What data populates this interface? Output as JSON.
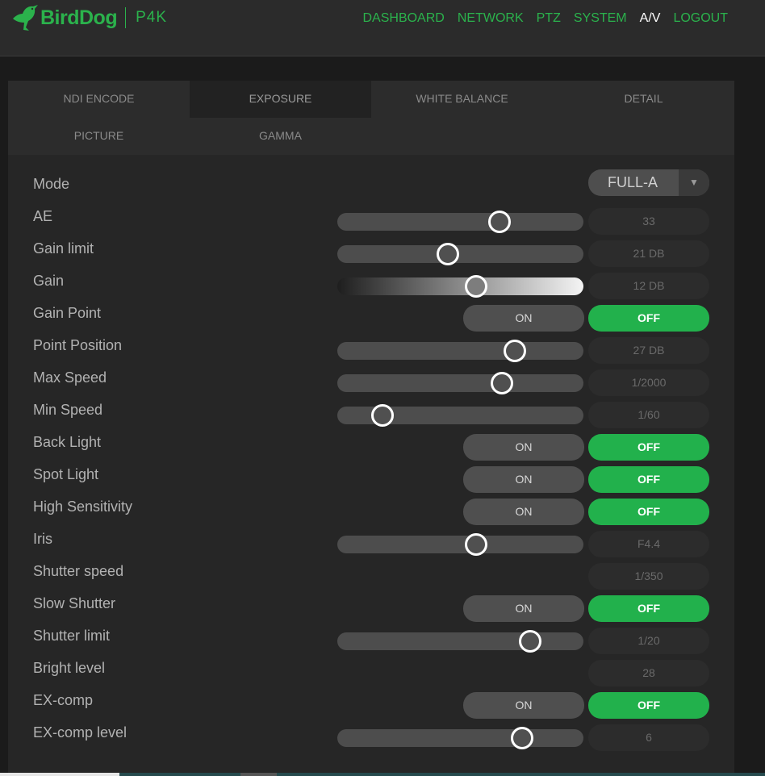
{
  "header": {
    "brand": "BirdDog",
    "model": "P4K",
    "nav": [
      {
        "label": "DASHBOARD",
        "active": false
      },
      {
        "label": "NETWORK",
        "active": false
      },
      {
        "label": "PTZ",
        "active": false
      },
      {
        "label": "SYSTEM",
        "active": false
      },
      {
        "label": "A/V",
        "active": true
      },
      {
        "label": "LOGOUT",
        "active": false
      }
    ]
  },
  "tabs": [
    {
      "label": "NDI ENCODE",
      "active": false
    },
    {
      "label": "EXPOSURE",
      "active": true
    },
    {
      "label": "WHITE BALANCE",
      "active": false
    },
    {
      "label": "DETAIL",
      "active": false
    },
    {
      "label": "PICTURE",
      "active": false
    },
    {
      "label": "GAMMA",
      "active": false
    }
  ],
  "exposure": {
    "mode": {
      "label": "Mode",
      "value": "FULL-A"
    },
    "ae": {
      "label": "AE",
      "value": "33",
      "level": 0.66
    },
    "gain_limit": {
      "label": "Gain limit",
      "value": "21 DB",
      "level": 0.45
    },
    "gain": {
      "label": "Gain",
      "value": "12 DB",
      "level": 0.565
    },
    "gain_point": {
      "label": "Gain Point",
      "on": "ON",
      "off": "OFF",
      "state": "off"
    },
    "point_position": {
      "label": "Point Position",
      "value": "27 DB",
      "level": 0.72
    },
    "max_speed": {
      "label": "Max Speed",
      "value": "1/2000",
      "level": 0.67
    },
    "min_speed": {
      "label": "Min Speed",
      "value": "1/60",
      "level": 0.185
    },
    "back_light": {
      "label": "Back Light",
      "on": "ON",
      "off": "OFF",
      "state": "off"
    },
    "spot_light": {
      "label": "Spot Light",
      "on": "ON",
      "off": "OFF",
      "state": "off"
    },
    "high_sensitivity": {
      "label": "High Sensitivity",
      "on": "ON",
      "off": "OFF",
      "state": "off"
    },
    "iris": {
      "label": "Iris",
      "value": "F4.4",
      "level": 0.565
    },
    "shutter_speed": {
      "label": "Shutter speed",
      "value": "1/350"
    },
    "slow_shutter": {
      "label": "Slow Shutter",
      "on": "ON",
      "off": "OFF",
      "state": "off"
    },
    "shutter_limit": {
      "label": "Shutter limit",
      "value": "1/20",
      "level": 0.785
    },
    "bright_level": {
      "label": "Bright level",
      "value": "28"
    },
    "ex_comp": {
      "label": "EX-comp",
      "on": "ON",
      "off": "OFF",
      "state": "off"
    },
    "ex_comp_level": {
      "label": "EX-comp level",
      "value": "6",
      "level": 0.75
    }
  },
  "colors": {
    "accent": "#2bb24c",
    "toggle_off": "#22b14c",
    "background": "#262626"
  }
}
